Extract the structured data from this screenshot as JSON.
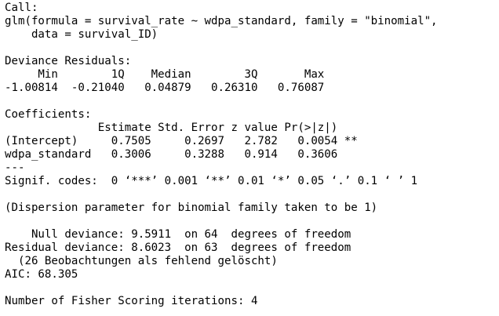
{
  "console": {
    "lines": [
      "Call:",
      "glm(formula = survival_rate ~ wdpa_standard, family = \"binomial\",",
      "    data = survival_ID)",
      "",
      "Deviance Residuals:",
      "     Min        1Q    Median        3Q       Max",
      "-1.00814  -0.21040   0.04879   0.26310   0.76087",
      "",
      "Coefficients:",
      "              Estimate Std. Error z value Pr(>|z|)",
      "(Intercept)     0.7505     0.2697   2.782   0.0054 **",
      "wdpa_standard   0.3006     0.3288   0.914   0.3606",
      "---",
      "Signif. codes:  0 ‘***’ 0.001 ‘**’ 0.01 ‘*’ 0.05 ‘.’ 0.1 ‘ ’ 1",
      "",
      "(Dispersion parameter for binomial family taken to be 1)",
      "",
      "    Null deviance: 9.5911  on 64  degrees of freedom",
      "Residual deviance: 8.6023  on 63  degrees of freedom",
      "  (26 Beobachtungen als fehlend gelöscht)",
      "AIC: 68.305",
      "",
      "Number of Fisher Scoring iterations: 4"
    ]
  }
}
